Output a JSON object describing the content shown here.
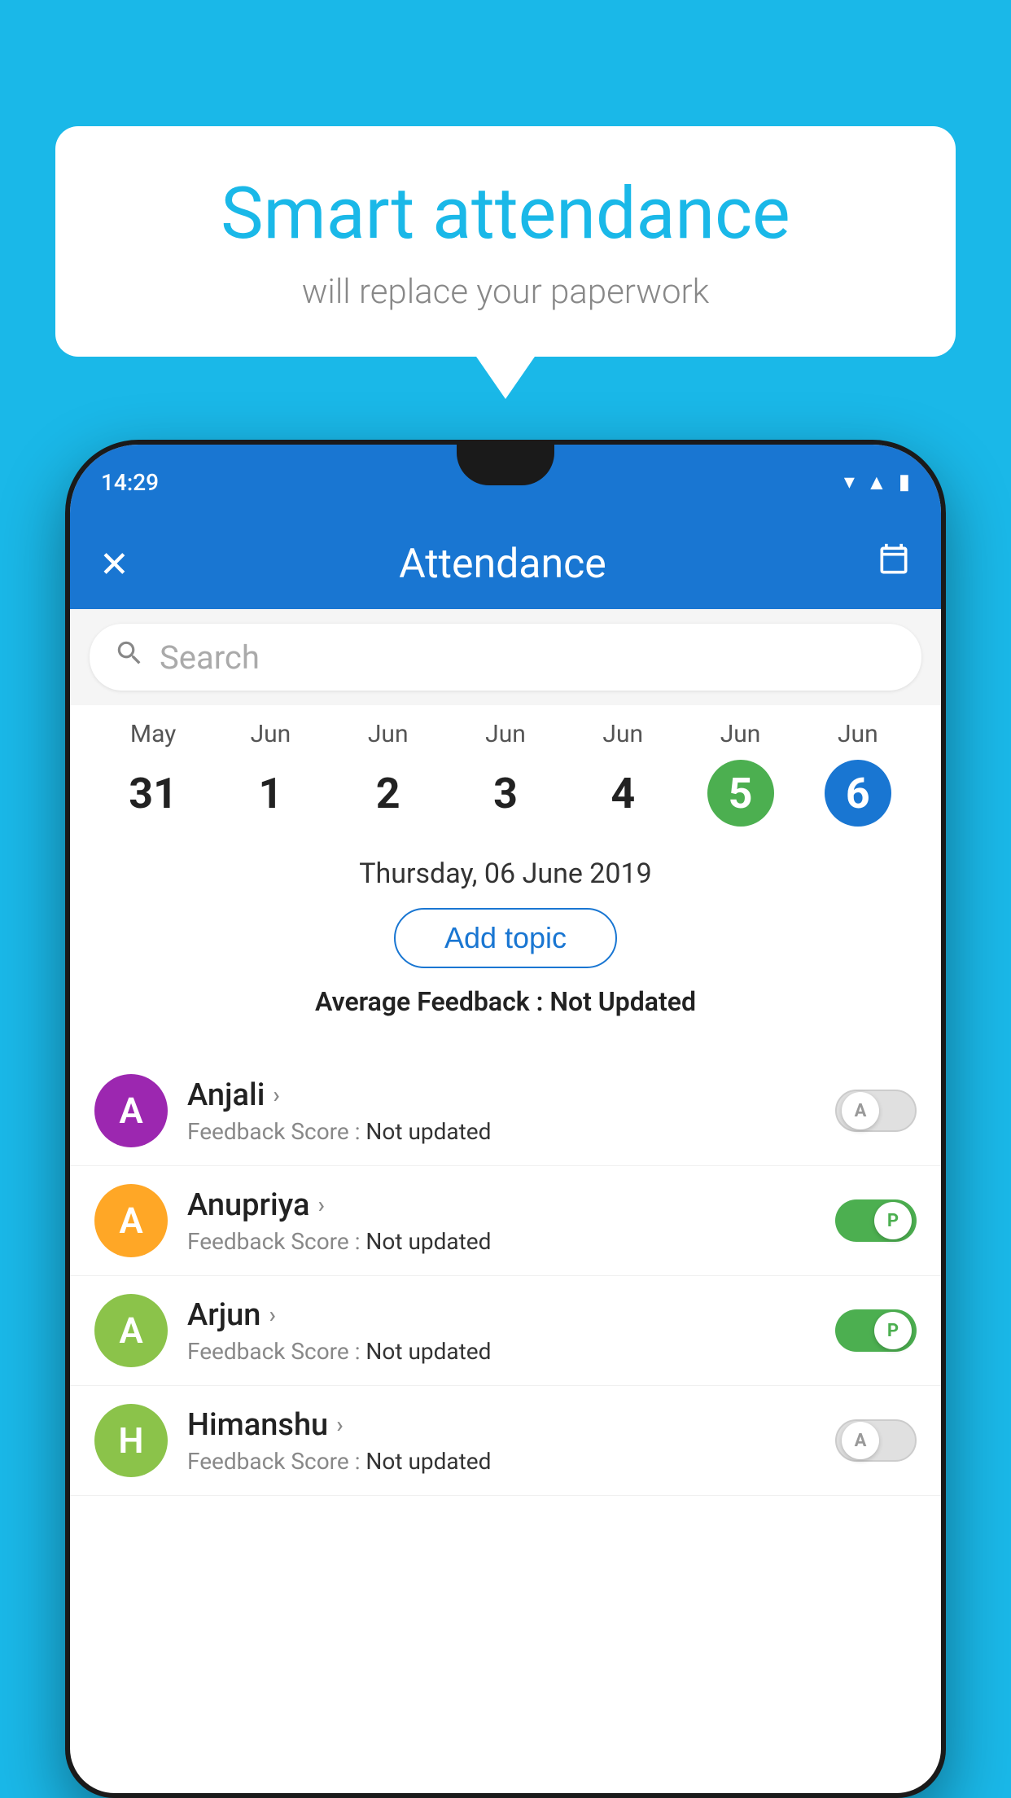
{
  "background_color": "#1ab8e8",
  "speech_bubble": {
    "title": "Smart attendance",
    "subtitle": "will replace your paperwork"
  },
  "status_bar": {
    "time": "14:29",
    "icons": [
      "wifi",
      "signal",
      "battery"
    ]
  },
  "app_bar": {
    "title": "Attendance",
    "close_icon": "✕",
    "calendar_icon": "📅"
  },
  "search": {
    "placeholder": "Search"
  },
  "calendar": {
    "days": [
      {
        "month": "May",
        "date": "31",
        "state": "normal"
      },
      {
        "month": "Jun",
        "date": "1",
        "state": "normal"
      },
      {
        "month": "Jun",
        "date": "2",
        "state": "normal"
      },
      {
        "month": "Jun",
        "date": "3",
        "state": "normal"
      },
      {
        "month": "Jun",
        "date": "4",
        "state": "normal"
      },
      {
        "month": "Jun",
        "date": "5",
        "state": "today"
      },
      {
        "month": "Jun",
        "date": "6",
        "state": "selected"
      }
    ]
  },
  "selected_date_label": "Thursday, 06 June 2019",
  "add_topic_label": "Add topic",
  "avg_feedback_label": "Average Feedback : ",
  "avg_feedback_value": "Not Updated",
  "students": [
    {
      "name": "Anjali",
      "initial": "A",
      "avatar_color": "#9c27b0",
      "feedback_label": "Feedback Score : ",
      "feedback_value": "Not updated",
      "attendance": "absent",
      "toggle_label": "A"
    },
    {
      "name": "Anupriya",
      "initial": "A",
      "avatar_color": "#ffa726",
      "feedback_label": "Feedback Score : ",
      "feedback_value": "Not updated",
      "attendance": "present",
      "toggle_label": "P"
    },
    {
      "name": "Arjun",
      "initial": "A",
      "avatar_color": "#8bc34a",
      "feedback_label": "Feedback Score : ",
      "feedback_value": "Not updated",
      "attendance": "present",
      "toggle_label": "P"
    },
    {
      "name": "Himanshu",
      "initial": "H",
      "avatar_color": "#8bc34a",
      "feedback_label": "Feedback Score : ",
      "feedback_value": "Not updated",
      "attendance": "absent",
      "toggle_label": "A"
    }
  ]
}
